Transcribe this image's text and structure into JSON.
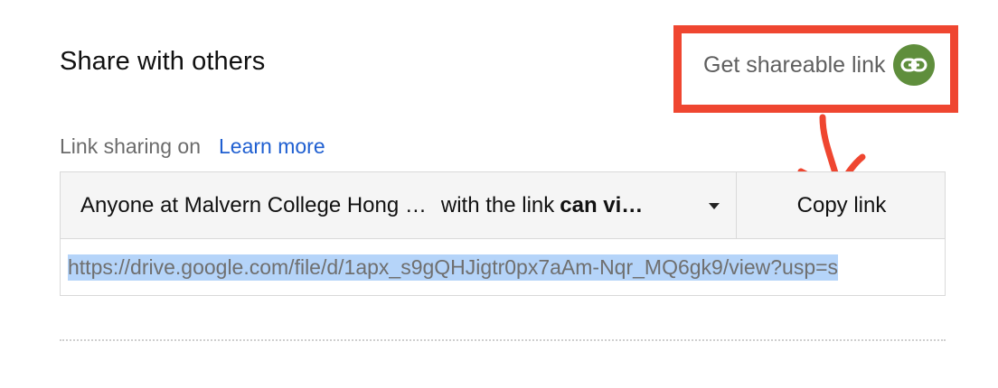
{
  "dialog": {
    "title": "Share with others",
    "get_link_label": "Get shareable link",
    "status_text": "Link sharing on",
    "learn_more": "Learn more",
    "access_org": "Anyone at Malvern College Hong …",
    "access_with": "with the link",
    "access_permission": "can vi…",
    "copy_label": "Copy link",
    "url": "https://drive.google.com/file/d/1apx_s9gQHJigtr0px7aAm-Nqr_MQ6gk9/view?usp=s"
  },
  "icons": {
    "link": "link-icon",
    "dropdown": "caret-down-icon",
    "annotation_arrow": "arrow-icon"
  },
  "colors": {
    "link_icon_bg": "#5f8e3c",
    "annotation": "#ef4630",
    "learn_more": "#1f5fd1",
    "selection": "#b5d4f9"
  }
}
